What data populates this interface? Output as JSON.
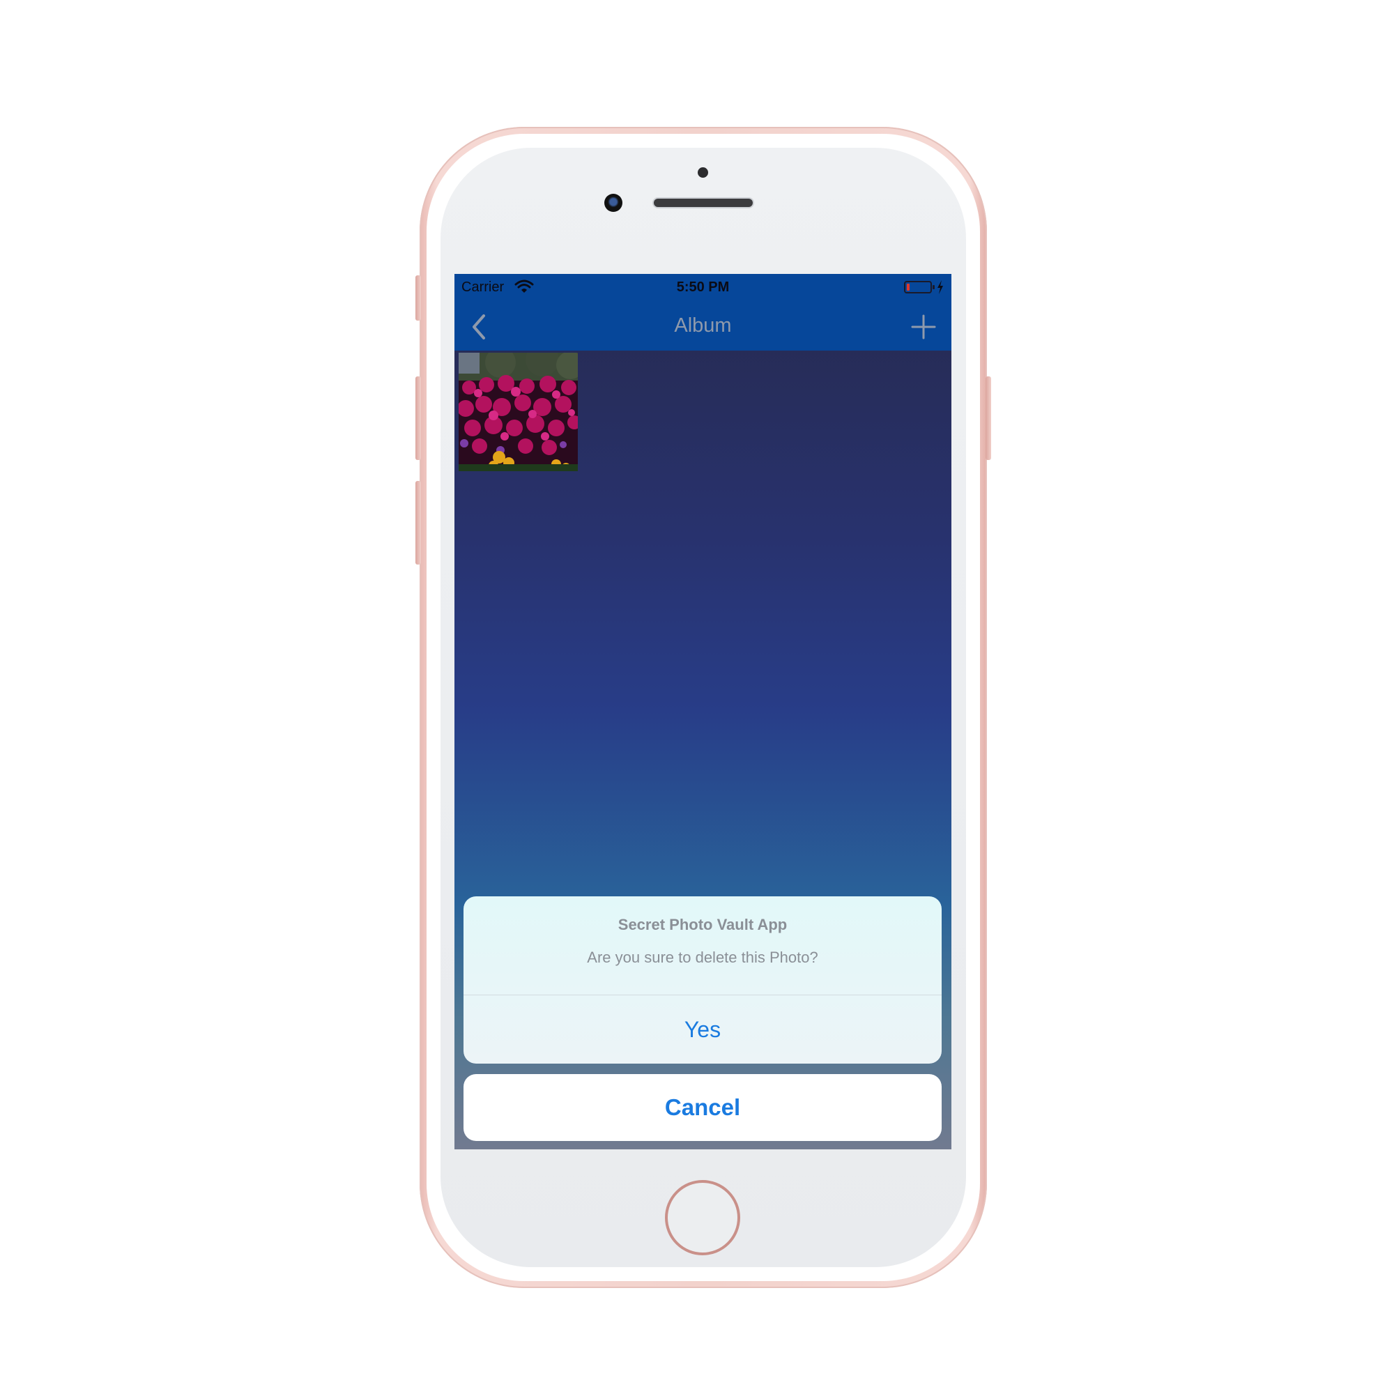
{
  "status_bar": {
    "carrier": "Carrier",
    "time": "5:50 PM"
  },
  "nav": {
    "title": "Album",
    "back_icon": "chevron-left-icon",
    "add_icon": "plus-icon"
  },
  "album": {
    "photos": [
      "flower-bed-photo"
    ]
  },
  "action_sheet": {
    "title": "Secret Photo Vault App",
    "message": "Are you sure to delete this Photo?",
    "confirm_label": "Yes",
    "cancel_label": "Cancel"
  },
  "colors": {
    "nav_background": "#06479a",
    "action_blue": "#1a7be0",
    "phone_frame": "#f2d2cc",
    "battery_low": "#e0382c"
  }
}
